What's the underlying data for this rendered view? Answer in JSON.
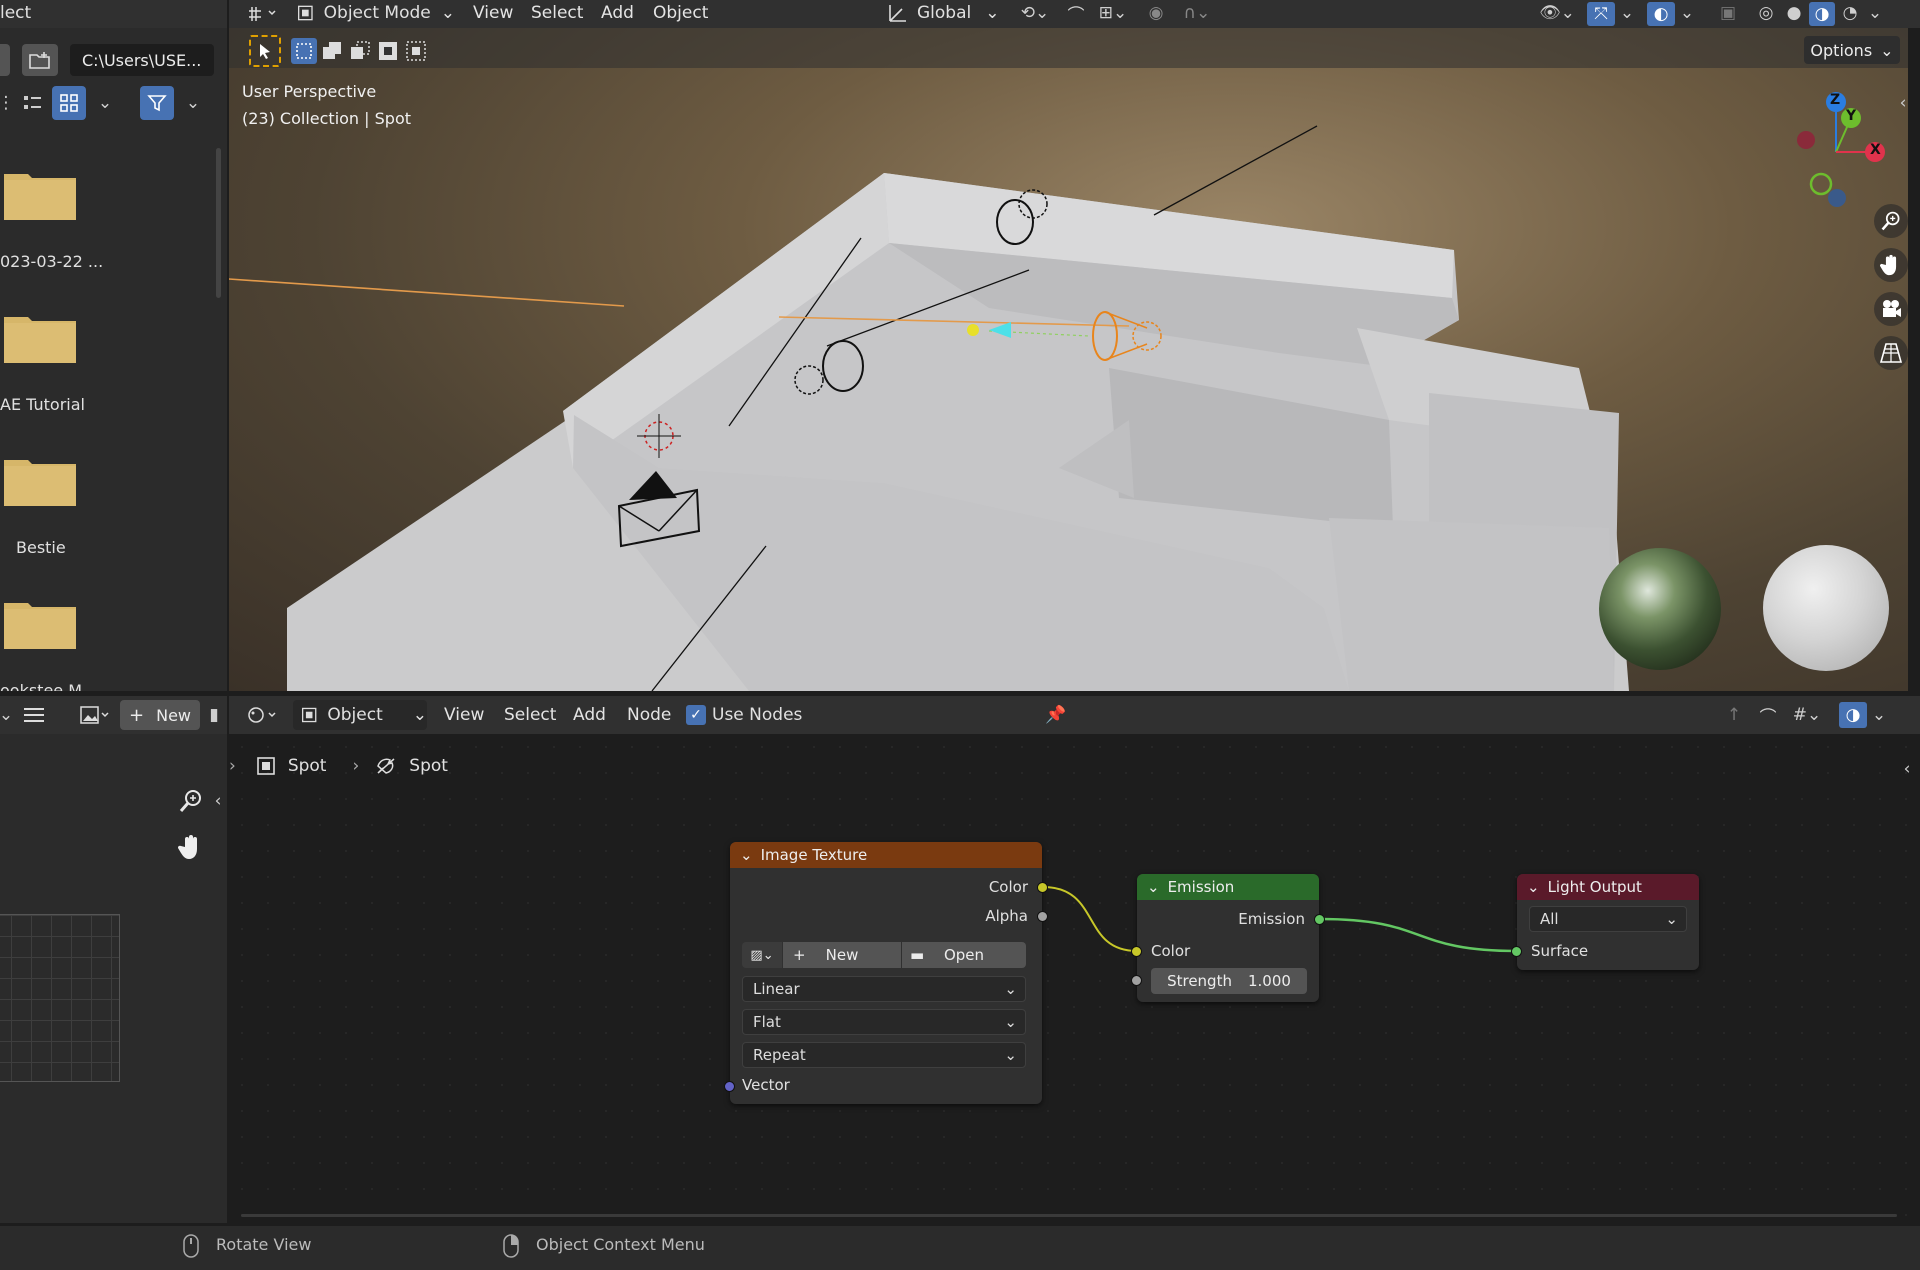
{
  "file_browser": {
    "title_partial": "lect",
    "path": "C:\\Users\\USE...",
    "folders": [
      {
        "name": "023-03-22 ..."
      },
      {
        "name": "AE Tutorial"
      },
      {
        "name": "Bestie"
      },
      {
        "name": "ookstee M..."
      }
    ]
  },
  "viewport": {
    "mode": "Object Mode",
    "menus": [
      "View",
      "Select",
      "Add",
      "Object"
    ],
    "orientation": "Global",
    "options_label": "Options",
    "overlay_line1": "User Perspective",
    "overlay_line2": "(23) Collection | Spot",
    "gizmo_axes": {
      "z": "Z",
      "y": "Y",
      "x": "X"
    }
  },
  "image_editor": {
    "new_label": "New"
  },
  "node_editor": {
    "object_mode": "Object",
    "menus": [
      "View",
      "Select",
      "Add",
      "Node"
    ],
    "use_nodes_label": "Use Nodes",
    "breadcrumb": [
      "Spot",
      "Spot"
    ]
  },
  "nodes": {
    "image_texture": {
      "title": "Image Texture",
      "out_color": "Color",
      "out_alpha": "Alpha",
      "new_label": "New",
      "open_label": "Open",
      "interpolation": "Linear",
      "projection": "Flat",
      "extension": "Repeat",
      "in_vector": "Vector",
      "color": "#7a3a10"
    },
    "emission": {
      "title": "Emission",
      "out_emission": "Emission",
      "in_color": "Color",
      "strength_label": "Strength",
      "strength_value": "1.000",
      "color": "#2a6a2a"
    },
    "light_output": {
      "title": "Light Output",
      "target": "All",
      "in_surface": "Surface",
      "color": "#5a1a2a"
    }
  },
  "status_bar": {
    "left_action": "Rotate View",
    "mid_action": "Object Context Menu"
  },
  "colors": {
    "accent_blue": "#4772b3",
    "socket_yellow": "#c7c729",
    "socket_green": "#63c763",
    "socket_gray": "#a1a1a1",
    "socket_purple": "#6363c7"
  }
}
